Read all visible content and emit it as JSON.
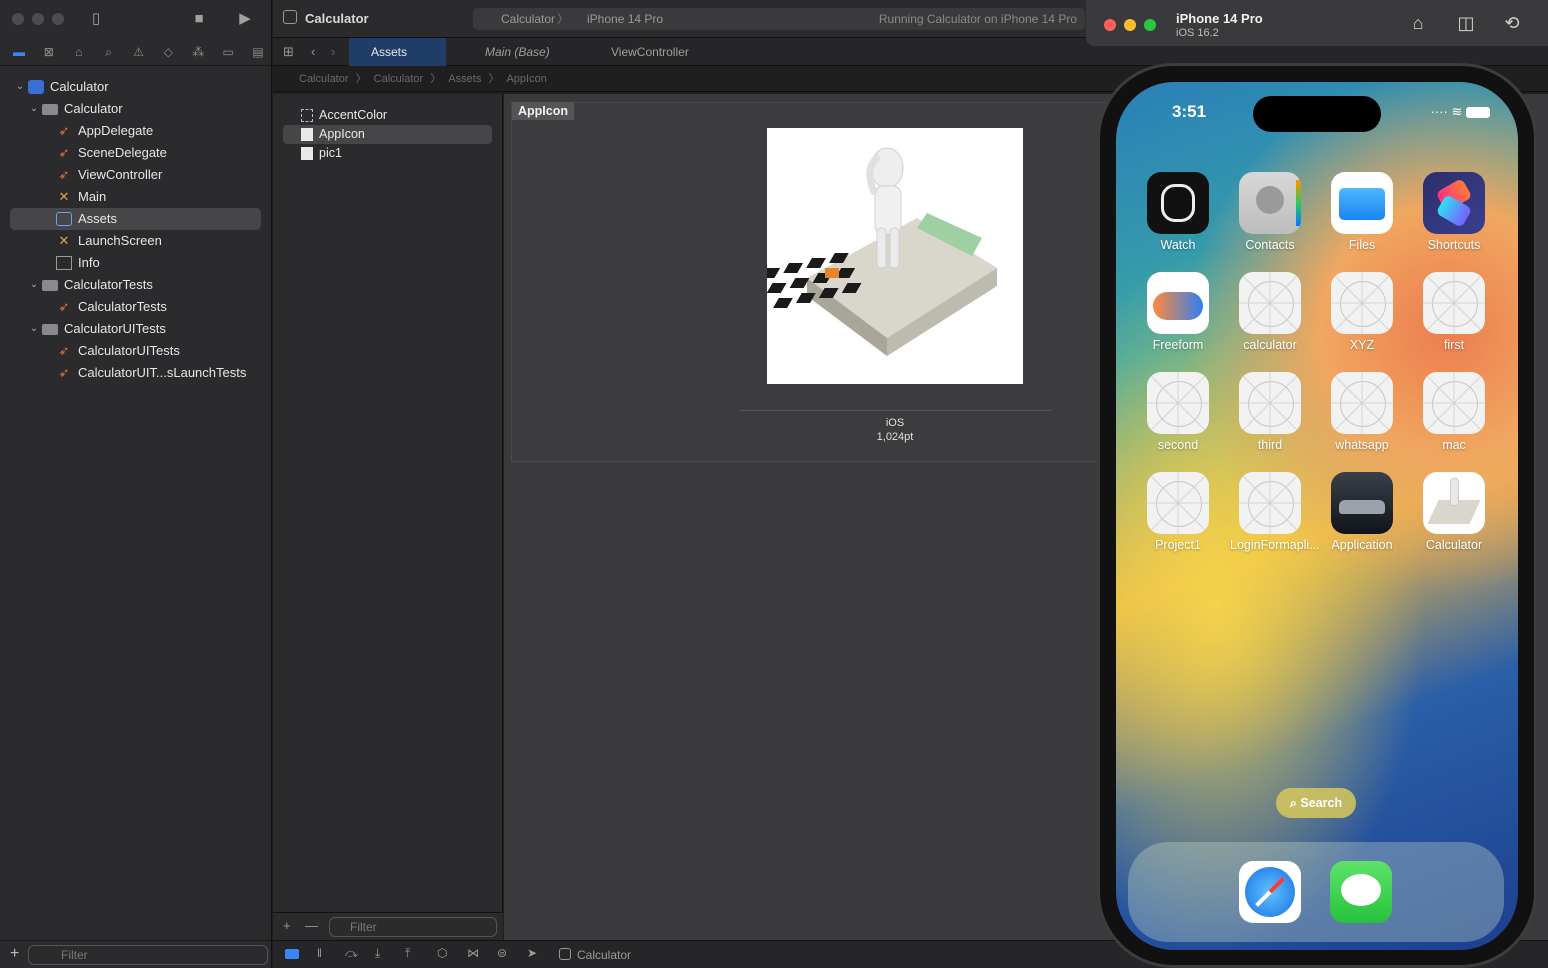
{
  "navigator": {
    "tree": [
      {
        "label": "Calculator",
        "kind": "project",
        "level": 0,
        "disclosure": "open"
      },
      {
        "label": "Calculator",
        "kind": "folder",
        "level": 1,
        "disclosure": "open"
      },
      {
        "label": "AppDelegate",
        "kind": "swift",
        "level": 2
      },
      {
        "label": "SceneDelegate",
        "kind": "swift",
        "level": 2
      },
      {
        "label": "ViewController",
        "kind": "swift",
        "level": 2
      },
      {
        "label": "Main",
        "kind": "ib",
        "level": 2
      },
      {
        "label": "Assets",
        "kind": "assets",
        "level": 2,
        "selected": true
      },
      {
        "label": "LaunchScreen",
        "kind": "ib",
        "level": 2
      },
      {
        "label": "Info",
        "kind": "plist",
        "level": 2
      },
      {
        "label": "CalculatorTests",
        "kind": "folder",
        "level": 1,
        "disclosure": "open"
      },
      {
        "label": "CalculatorTests",
        "kind": "swift",
        "level": 2
      },
      {
        "label": "CalculatorUITests",
        "kind": "folder",
        "level": 1,
        "disclosure": "open"
      },
      {
        "label": "CalculatorUITests",
        "kind": "swift",
        "level": 2
      },
      {
        "label": "CalculatorUIT...sLaunchTests",
        "kind": "swift",
        "level": 2
      }
    ],
    "filter_placeholder": "Filter"
  },
  "editor": {
    "title": "Calculator",
    "scheme": {
      "target": "Calculator",
      "device": "iPhone 14 Pro",
      "status": "Running Calculator on iPhone 14 Pro"
    },
    "tabs": [
      {
        "label": "Assets",
        "active": true
      },
      {
        "label": "Main (Base)",
        "active": false
      },
      {
        "label": "ViewController",
        "active": false
      }
    ],
    "breadcrumb": [
      "Calculator",
      "Calculator",
      "Assets",
      "AppIcon"
    ],
    "assets": [
      {
        "label": "AccentColor",
        "selected": false
      },
      {
        "label": "AppIcon",
        "selected": true
      },
      {
        "label": "pic1",
        "selected": false
      }
    ],
    "asset_filter_placeholder": "Filter",
    "panel_title": "AppIcon",
    "well_platform": "iOS",
    "well_size": "1,024pt",
    "status_target": "Calculator"
  },
  "simulator": {
    "device": "iPhone 14 Pro",
    "os": "iOS 16.2",
    "time": "3:51",
    "apps": [
      {
        "name": "Watch",
        "icon": "watch-icon"
      },
      {
        "name": "Contacts",
        "icon": "contacts-icon"
      },
      {
        "name": "Files",
        "icon": "files-icon"
      },
      {
        "name": "Shortcuts",
        "icon": "shortcuts-icon"
      },
      {
        "name": "Freeform",
        "icon": "freeform-icon"
      },
      {
        "name": "calculator",
        "icon": "placeholder-icon"
      },
      {
        "name": "XYZ",
        "icon": "placeholder-icon"
      },
      {
        "name": "first",
        "icon": "placeholder-icon"
      },
      {
        "name": "second",
        "icon": "placeholder-icon"
      },
      {
        "name": "third",
        "icon": "placeholder-icon"
      },
      {
        "name": "whatsapp",
        "icon": "placeholder-icon"
      },
      {
        "name": "mac",
        "icon": "placeholder-icon"
      },
      {
        "name": "Project1",
        "icon": "placeholder-icon"
      },
      {
        "name": "LoginFormapli...",
        "icon": "placeholder-icon"
      },
      {
        "name": "Application",
        "icon": "car-photo-icon"
      },
      {
        "name": "Calculator",
        "icon": "calculator-man-icon"
      }
    ],
    "search_label": "Search",
    "dock": [
      {
        "icon": "safari-icon"
      },
      {
        "icon": "messages-icon"
      }
    ]
  },
  "colors": {
    "accent": "#3b86f7",
    "selection": "#464648",
    "tab_active": "#1f3d66"
  }
}
